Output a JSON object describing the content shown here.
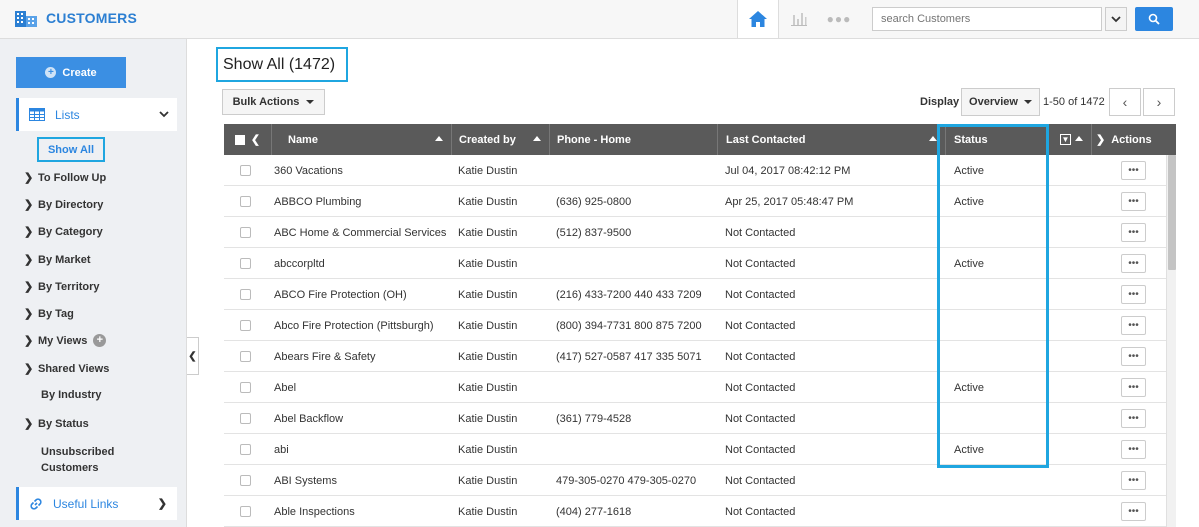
{
  "header": {
    "title": "CUSTOMERS",
    "search_placeholder": "search Customers",
    "icons": [
      "customers-building-icon",
      "home-icon",
      "bar-chart-icon",
      "more-dots-icon",
      "search-icon"
    ]
  },
  "sidebar": {
    "create_label": "Create",
    "lists_label": "Lists",
    "show_all_label": "Show All",
    "items": [
      {
        "label": "To Follow Up",
        "chevron": true
      },
      {
        "label": "By Directory",
        "chevron": true
      },
      {
        "label": "By Category",
        "chevron": true
      },
      {
        "label": "By Market",
        "chevron": true
      },
      {
        "label": "By Territory",
        "chevron": true
      },
      {
        "label": "By Tag",
        "chevron": true
      },
      {
        "label": "My Views",
        "chevron": true
      },
      {
        "label": "Shared Views",
        "chevron": true
      },
      {
        "label": "By Industry",
        "chevron": false
      },
      {
        "label": "By Status",
        "chevron": true
      },
      {
        "label": "Unsubscribed Customers",
        "chevron": false
      }
    ],
    "useful_links_label": "Useful Links"
  },
  "main": {
    "page_title": "Show All (1472)",
    "bulk_actions_label": "Bulk Actions",
    "display_label": "Display",
    "display_value": "Overview",
    "pager_text": "1-50 of 1472",
    "columns": {
      "name": "Name",
      "created_by": "Created by",
      "phone_home": "Phone - Home",
      "last_contacted": "Last Contacted",
      "status": "Status",
      "actions": "Actions"
    },
    "rows": [
      {
        "name": "360 Vacations",
        "created_by": "Katie Dustin",
        "phone": "",
        "last_contacted": "Jul 04, 2017 08:42:12 PM",
        "status": "Active"
      },
      {
        "name": "ABBCO Plumbing",
        "created_by": "Katie Dustin",
        "phone": "(636) 925-0800",
        "last_contacted": "Apr 25, 2017 05:48:47 PM",
        "status": "Active"
      },
      {
        "name": "ABC Home & Commercial Services",
        "created_by": "Katie Dustin",
        "phone": "(512) 837-9500",
        "last_contacted": "Not Contacted",
        "status": ""
      },
      {
        "name": "abccorpltd",
        "created_by": "Katie Dustin",
        "phone": "",
        "last_contacted": "Not Contacted",
        "status": "Active"
      },
      {
        "name": "ABCO Fire Protection (OH)",
        "created_by": "Katie Dustin",
        "phone": "(216) 433-7200 440 433 7209",
        "last_contacted": "Not Contacted",
        "status": ""
      },
      {
        "name": "Abco Fire Protection (Pittsburgh)",
        "created_by": "Katie Dustin",
        "phone": "(800) 394-7731 800 875 7200",
        "last_contacted": "Not Contacted",
        "status": ""
      },
      {
        "name": "Abears Fire & Safety",
        "created_by": "Katie Dustin",
        "phone": "(417) 527-0587 417 335 5071",
        "last_contacted": "Not Contacted",
        "status": ""
      },
      {
        "name": "Abel",
        "created_by": "Katie Dustin",
        "phone": "",
        "last_contacted": "Not Contacted",
        "status": "Active"
      },
      {
        "name": "Abel Backflow",
        "created_by": "Katie Dustin",
        "phone": "(361) 779-4528",
        "last_contacted": "Not Contacted",
        "status": ""
      },
      {
        "name": "abi",
        "created_by": "Katie Dustin",
        "phone": "",
        "last_contacted": "Not Contacted",
        "status": "Active"
      },
      {
        "name": "ABI Systems",
        "created_by": "Katie Dustin",
        "phone": "479-305-0270 479-305-0270",
        "last_contacted": "Not Contacted",
        "status": ""
      },
      {
        "name": "Able Inspections",
        "created_by": "Katie Dustin",
        "phone": "(404) 277-1618",
        "last_contacted": "Not Contacted",
        "status": ""
      }
    ]
  },
  "colors": {
    "brand_blue": "#2c86e0",
    "highlight_cyan": "#1fa6e0",
    "table_header": "#5a5a5a"
  }
}
